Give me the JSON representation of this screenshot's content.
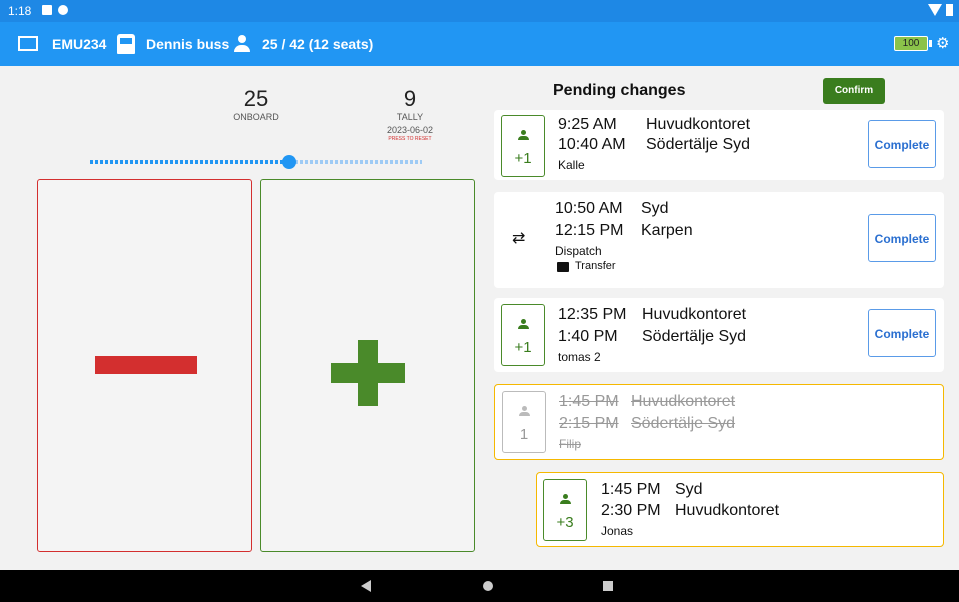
{
  "status": {
    "time": "1:18"
  },
  "app_bar": {
    "vehicle_id": "EMU234",
    "bus_name": "Dennis buss",
    "occupancy": "25 / 42 (12 seats)",
    "battery": "100",
    "colors": {
      "bar": "#2196f3",
      "status": "#1e88e5"
    }
  },
  "counter": {
    "onboard_value": "25",
    "onboard_label": "ONBOARD",
    "tally_value": "9",
    "tally_label": "TALLY",
    "tally_date": "2023-06-02",
    "reset_hint": "PRESS TO RESET",
    "slider_level": 0.6
  },
  "pending": {
    "title": "Pending changes",
    "confirm_label": "Confirm",
    "items": [
      {
        "delta": "+1",
        "t1": "9:25 AM",
        "p1": "Huvudkontoret",
        "t2": "10:40 AM",
        "p2": "Södertälje Syd",
        "name": "Kalle",
        "action": "Complete"
      },
      {
        "t1": "10:50 AM",
        "p1": "Syd",
        "t2": "12:15 PM",
        "p2": "Karpen",
        "name": "Dispatch",
        "note": "Transfer",
        "action": "Complete"
      },
      {
        "delta": "+1",
        "t1": "12:35 PM",
        "p1": "Huvudkontoret",
        "t2": "1:40 PM",
        "p2": "Södertälje Syd",
        "name": "tomas 2",
        "action": "Complete"
      },
      {
        "delta": "1",
        "t1": "1:45 PM",
        "p1": "Huvudkontoret",
        "t2": "2:15 PM",
        "p2": "Södertälje Syd",
        "name": "Filip"
      },
      {
        "delta": "+3",
        "t1": "1:45 PM",
        "p1": "Syd",
        "t2": "2:30 PM",
        "p2": "Huvudkontoret",
        "name": "Jonas"
      }
    ]
  }
}
